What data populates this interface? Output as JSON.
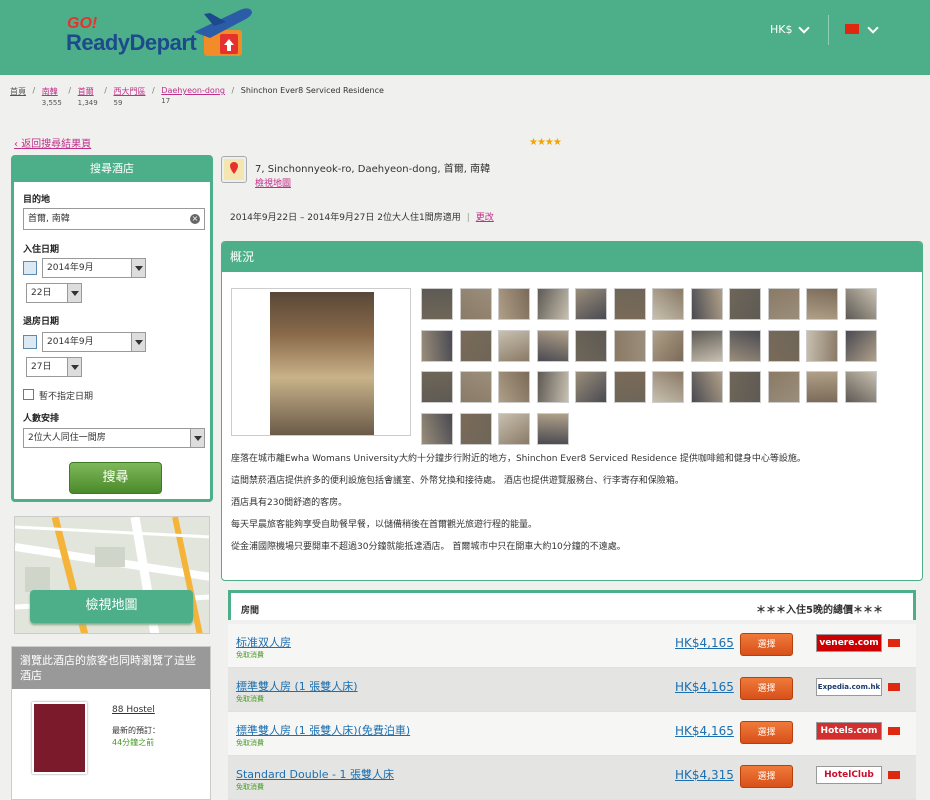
{
  "header": {
    "logo_go": "GO!",
    "logo_text": "ReadyDepart",
    "currency": "HK$"
  },
  "breadcrumb": [
    {
      "label": "首頁",
      "count": ""
    },
    {
      "label": "南韓",
      "count": "3,555"
    },
    {
      "label": "首爾",
      "count": "1,349"
    },
    {
      "label": "西大門區",
      "count": "59"
    },
    {
      "label": "Daehyeon-dong",
      "count": "17"
    },
    {
      "label": "Shinchon Ever8 Serviced Residence",
      "count": ""
    }
  ],
  "back_link": "返回搜尋結果頁",
  "stars": "★★★★",
  "search": {
    "title": "搜尋酒店",
    "dest_label": "目的地",
    "dest_value": "首爾, 南韓",
    "checkin_label": "入住日期",
    "checkin_month": "2014年9月",
    "checkin_day": "22日",
    "checkout_label": "退房日期",
    "checkout_month": "2014年9月",
    "checkout_day": "27日",
    "nodate_label": "暫不指定日期",
    "people_label": "人數安排",
    "people_value": "2位大人同住一間房",
    "button": "搜尋"
  },
  "map_button": "檢視地圖",
  "similar": {
    "title": "瀏覽此酒店的旅客也同時瀏覽了這些酒店",
    "hotel_name": "88 Hostel",
    "last_booked_label": "最新的預訂：",
    "last_booked_value": "44分鐘之前"
  },
  "hotel": {
    "address": "7, Sinchonnyeok-ro, Daehyeon-dong, 首爾, 南韓",
    "show_map": "檢視地圖",
    "dates": "2014年9月22日 – 2014年9月27日 2位大人住1間房適用",
    "change": "更改"
  },
  "overview": {
    "title": "概況",
    "paragraphs": [
      "座落在城市離Ewha Womans University大約十分鐘步行附近的地方，Shinchon Ever8 Serviced Residence 提供咖啡館和健身中心等設施。",
      "這間禁菸酒店提供許多的便利設施包括會議室、外幣兌換和接待處。 酒店也提供遊覽服務台、行李寄存和保險箱。",
      "酒店具有230間舒適的客房。",
      "每天早晨旅客能夠享受自助餐早餐，以儲備稍後在首爾觀光旅遊行程的能量。",
      "從金浦國際機場只要開車不超過30分鐘就能抵達酒店。 首爾城市中只在開車大約10分鐘的不遠處。"
    ]
  },
  "rooms": {
    "header": "房間",
    "total_label": "＊＊＊入住5晚的總價＊＊＊",
    "items": [
      {
        "name": "标准双人房",
        "sub": "免取消費",
        "price": "HK$4,165",
        "btn": "選擇",
        "vendor": "venere.com",
        "vendor_color": "#cc0000"
      },
      {
        "name": "標準雙人房 (1 張雙人床)",
        "sub": "免取消費",
        "price": "HK$4,165",
        "btn": "選擇",
        "vendor": "Expedia.com.hk",
        "vendor_color": "#1c3a6e"
      },
      {
        "name": "標準雙人房 (1 張雙人床)(免費泊車)",
        "sub": "免取消費",
        "price": "HK$4,165",
        "btn": "選擇",
        "vendor": "Hotels.com",
        "vendor_color": "#d32f2f"
      },
      {
        "name": "Standard Double - 1 張雙人床",
        "sub": "免取消費",
        "price": "HK$4,315",
        "btn": "選擇",
        "vendor": "HotelClub",
        "vendor_color": "#c8102e"
      }
    ]
  }
}
